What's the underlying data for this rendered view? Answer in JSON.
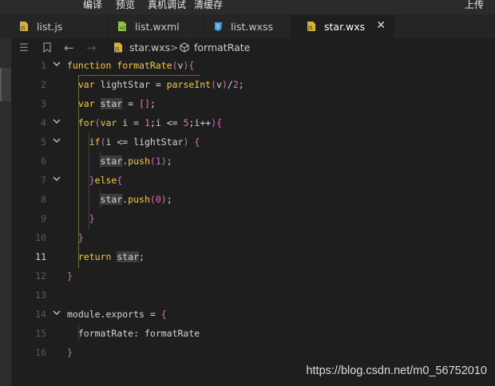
{
  "menu": {
    "items": [
      "编译",
      "预览",
      "真机调试",
      "清缓存"
    ],
    "right": "上传"
  },
  "tabs": [
    {
      "label": "list.js",
      "icon": "js-file-icon",
      "active": false
    },
    {
      "label": "list.wxml",
      "icon": "wxml-file-icon",
      "active": false
    },
    {
      "label": "list.wxss",
      "icon": "css-file-icon",
      "active": false
    },
    {
      "label": "star.wxs",
      "icon": "js-file-icon",
      "active": true
    }
  ],
  "tab_close": "✕",
  "breadcrumb": {
    "file": "star.wxs",
    "separator": ">",
    "symbol": "formatRate"
  },
  "editor": {
    "current_line": 11,
    "lines": [
      "function formatRate(v){",
      "  var lightStar = parseInt(v)/2;",
      "  var star = [];",
      "  for(var i = 1;i <= 5;i++){",
      "    if(i <= lightStar) {",
      "      star.push(1);",
      "    }else{",
      "      star.push(0);",
      "    }",
      "  }",
      "  return star;",
      "}",
      "",
      "module.exports = {",
      "  formatRate: formatRate",
      "}"
    ],
    "line_numbers": [
      "1",
      "2",
      "3",
      "4",
      "5",
      "6",
      "7",
      "8",
      "9",
      "10",
      "11",
      "12",
      "13",
      "14",
      "15",
      "16"
    ]
  },
  "watermark": "https://blog.csdn.net/m0_56752010",
  "colors": {
    "background": "#1e1e1e",
    "keyword": "#f2c94c",
    "number": "#e06cbe"
  }
}
